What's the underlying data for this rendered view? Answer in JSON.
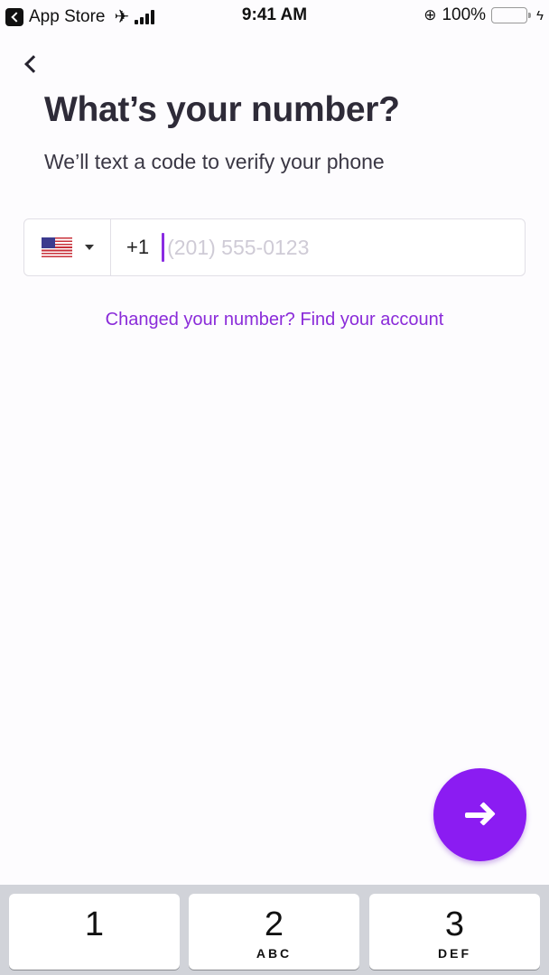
{
  "status_bar": {
    "back_app_label": "App Store",
    "time": "9:41 AM",
    "battery_percent": "100%",
    "battery_level": 1.0,
    "icons": [
      "back-app-icon",
      "airplane-icon",
      "signal-icon",
      "orientation-lock-icon",
      "battery-icon",
      "charging-icon"
    ]
  },
  "header": {
    "back_icon": "chevron-left-icon",
    "title": "What’s your number?",
    "subtitle": "We’ll text a code to verify your phone"
  },
  "phone_field": {
    "country": "US",
    "flag_icon": "us-flag-icon",
    "dial_code": "+1",
    "value": "",
    "placeholder": "(201) 555-0123"
  },
  "link": {
    "label": "Changed your number? Find your account"
  },
  "next_button": {
    "icon": "arrow-right-icon",
    "color": "#8b1cf2"
  },
  "colors": {
    "accent": "#8b1cf2",
    "link": "#8a2bd9",
    "title": "#2e2b38"
  },
  "keyboard": {
    "keys": [
      {
        "num": "1",
        "letters": ""
      },
      {
        "num": "2",
        "letters": "ABC"
      },
      {
        "num": "3",
        "letters": "DEF"
      }
    ]
  }
}
